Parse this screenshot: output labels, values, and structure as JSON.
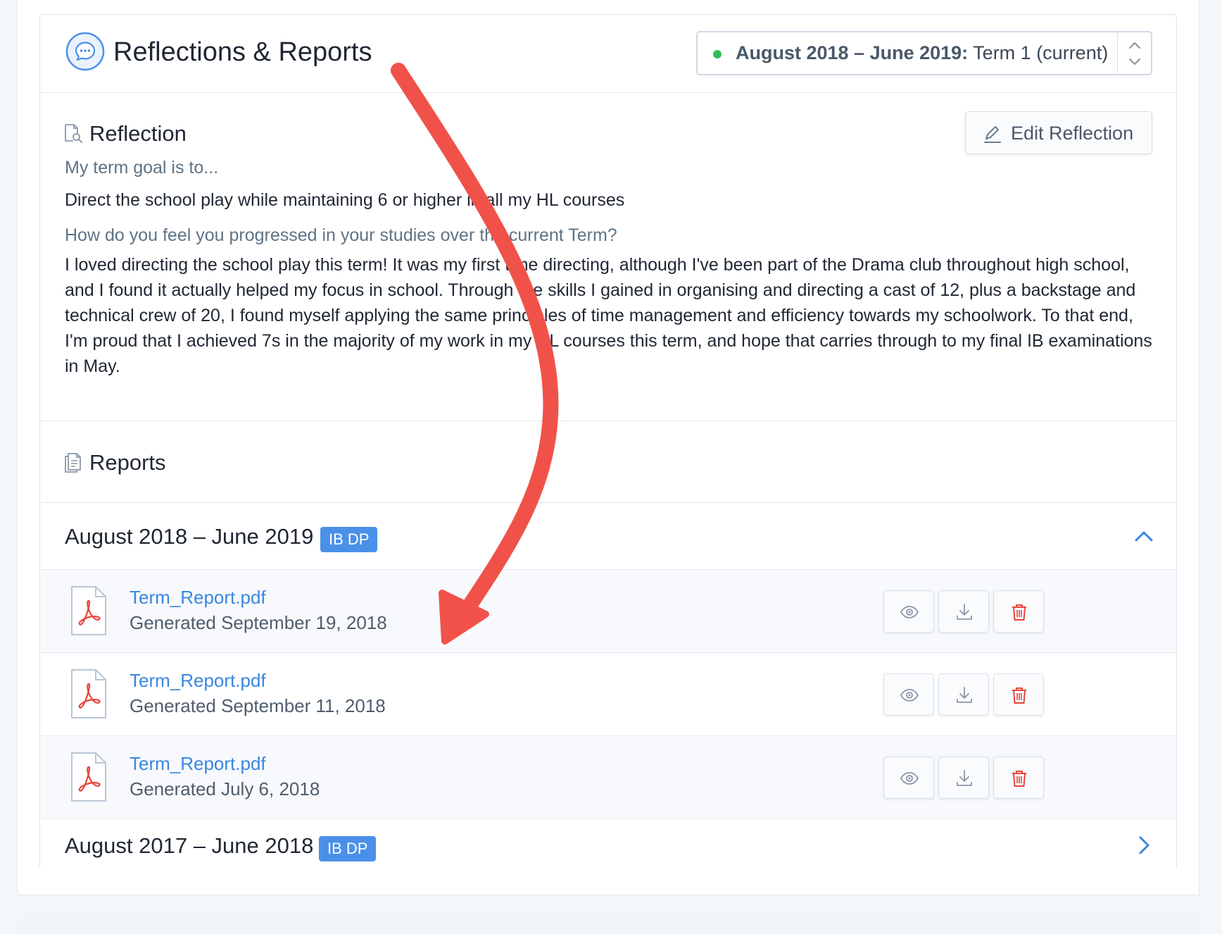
{
  "header": {
    "title": "Reflections & Reports",
    "term_select": {
      "bold_label": "August 2018 – June 2019:",
      "value_label": "Term 1 (current)"
    }
  },
  "reflection": {
    "title": "Reflection",
    "edit_label": "Edit Reflection",
    "q1": "My term goal is to...",
    "a1": "Direct the school play while maintaining 6 or higher in all my HL courses",
    "q2": "How do you feel you progressed in your studies over the current Term?",
    "a2": "I loved directing the school play this term! It was my first time directing, although I've been part of the Drama club throughout high school, and I found it actually helped my focus in school. Through the skills I gained in organising and directing a cast of 12, plus a backstage and technical crew of 20, I found myself applying the same principles of time management and efficiency towards my schoolwork. To that end, I'm proud that I achieved 7s in the majority of my work in my HL courses this term, and hope that carries through to my final IB examinations in May."
  },
  "reports": {
    "title": "Reports",
    "groups": [
      {
        "label": "August 2018 – June 2019",
        "badge": "IB DP",
        "expanded": true,
        "files": [
          {
            "name": "Term_Report.pdf",
            "date": "Generated September 19, 2018"
          },
          {
            "name": "Term_Report.pdf",
            "date": "Generated September 11, 2018"
          },
          {
            "name": "Term_Report.pdf",
            "date": "Generated July 6, 2018"
          }
        ]
      },
      {
        "label": "August 2017 – June 2018",
        "badge": "IB DP",
        "expanded": false
      }
    ]
  },
  "colors": {
    "accent": "#4a90e8",
    "link": "#3a86e0",
    "status_green": "#2fbd5b",
    "delete_red": "#e8453c",
    "annotation_arrow": "#f0524a"
  },
  "icons": {
    "header": "chat-bubble-icon",
    "reflection": "document-search-icon",
    "reports": "documents-icon",
    "file": "pdf-file-icon",
    "view": "eye-icon",
    "download": "download-icon",
    "delete": "trash-icon"
  }
}
